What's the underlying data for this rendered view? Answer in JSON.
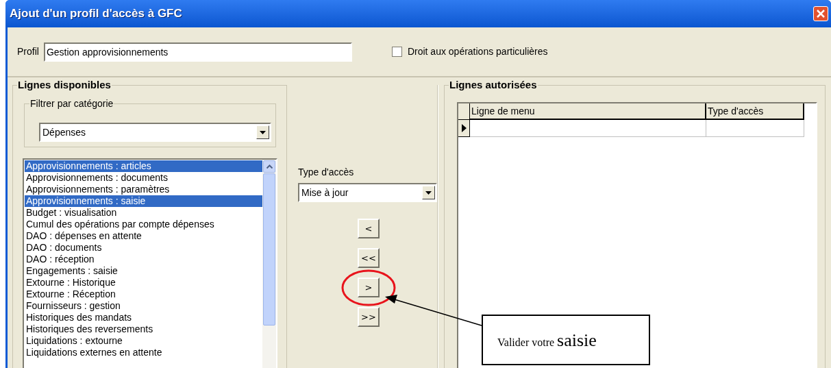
{
  "window": {
    "title": "Ajout d'un profil d'accès à GFC"
  },
  "profile": {
    "label": "Profil",
    "value": "Gestion approvisionnements"
  },
  "special_ops": {
    "label": "Droit aux opérations particulières",
    "checked": false
  },
  "available": {
    "title": "Lignes disponibles",
    "filter": {
      "title": "Filtrer par catégorie",
      "value": "Dépenses"
    },
    "items": [
      {
        "label": "Approvisionnements : articles",
        "selected": true
      },
      {
        "label": "Approvisionnements : documents",
        "selected": false
      },
      {
        "label": "Approvisionnements : paramètres",
        "selected": false
      },
      {
        "label": "Approvisionnements : saisie",
        "selected": true
      },
      {
        "label": "Budget : visualisation",
        "selected": false
      },
      {
        "label": "Cumul des opérations par compte dépenses",
        "selected": false
      },
      {
        "label": "DAO : dépenses en attente",
        "selected": false
      },
      {
        "label": "DAO : documents",
        "selected": false
      },
      {
        "label": "DAO : réception",
        "selected": false
      },
      {
        "label": "Engagements : saisie",
        "selected": false
      },
      {
        "label": "Extourne : Historique",
        "selected": false
      },
      {
        "label": "Extourne : Réception",
        "selected": false
      },
      {
        "label": "Fournisseurs : gestion",
        "selected": false
      },
      {
        "label": "Historiques des mandats",
        "selected": false
      },
      {
        "label": "Historiques des reversements",
        "selected": false
      },
      {
        "label": "Liquidations : extourne",
        "selected": false
      },
      {
        "label": "Liquidations externes en attente",
        "selected": false
      }
    ]
  },
  "access_type": {
    "label": "Type d'accès",
    "value": "Mise à jour"
  },
  "move_buttons": [
    {
      "label": "<",
      "highlighted": false
    },
    {
      "label": "<<",
      "highlighted": false
    },
    {
      "label": ">",
      "highlighted": true
    },
    {
      "label": ">>",
      "highlighted": false
    }
  ],
  "authorized": {
    "title": "Lignes autorisées",
    "columns": [
      "Ligne de menu",
      "Type d'accès"
    ]
  },
  "callout": {
    "text": "Valider votre",
    "emphasis": "saisie"
  }
}
